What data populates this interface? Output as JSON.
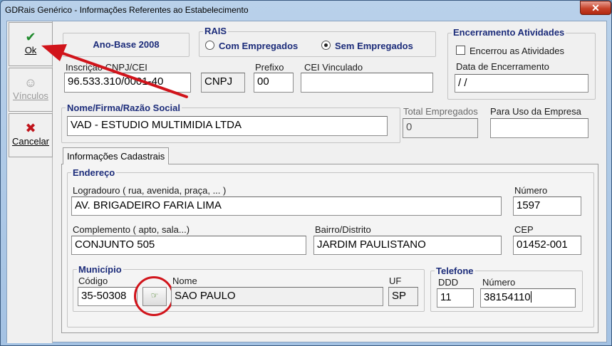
{
  "window": {
    "title": "GDRais Genérico - Informações Referentes ao Estabelecimento",
    "close_glyph": "✕"
  },
  "sidebar": {
    "ok": {
      "label": "Ok",
      "icon": "check-icon",
      "glyph": "✔"
    },
    "vinculos": {
      "label": "Vínculos",
      "icon": "person-icon",
      "glyph": "☺"
    },
    "cancelar": {
      "label": "Cancelar",
      "icon": "cross-icon",
      "glyph": "✖"
    }
  },
  "header": {
    "ano_base": "Ano-Base 2008"
  },
  "rais": {
    "title": "RAIS",
    "options": [
      "Com Empregados",
      "Sem Empregados"
    ],
    "selected": "Sem Empregados"
  },
  "identificacao": {
    "cnpj_label": "Inscrição CNPJ/CEI",
    "cnpj_value": "96.533.310/0001-40",
    "tipo": "CNPJ",
    "prefixo_label": "Prefixo",
    "prefixo_value": "00",
    "cei_label": "CEI Vinculado",
    "cei_value": ""
  },
  "encerramento": {
    "title": "Encerramento Atividades",
    "check_label": "Encerrou as Atividades",
    "data_label": "Data de Encerramento",
    "data_value": " / /"
  },
  "nome": {
    "label": "Nome/Firma/Razão Social",
    "value": "VAD - ESTUDIO MULTIMIDIA LTDA"
  },
  "total_empregados": {
    "label": "Total Empregados",
    "value": "0"
  },
  "uso_empresa": {
    "label": "Para Uso da Empresa",
    "value": ""
  },
  "tabs": [
    {
      "label": "Informações Cadastrais"
    }
  ],
  "endereco": {
    "title": "Endereço",
    "logradouro_label": "Logradouro ( rua, avenida, praça, ... )",
    "logradouro_value": "AV. BRIGADEIRO FARIA LIMA",
    "numero_label": "Número",
    "numero_value": "1597",
    "complemento_label": "Complemento ( apto, sala...)",
    "complemento_value": "CONJUNTO 505",
    "bairro_label": "Bairro/Distrito",
    "bairro_value": "JARDIM PAULISTANO",
    "cep_label": "CEP",
    "cep_value": "01452-001"
  },
  "municipio": {
    "title": "Município",
    "codigo_label": "Código",
    "codigo_value": "35-50308",
    "nome_label": "Nome",
    "nome_value": "SAO PAULO",
    "uf_label": "UF",
    "uf_value": "SP",
    "lookup_icon": "lookup-icon",
    "lookup_glyph": "☞"
  },
  "telefone": {
    "title": "Telefone",
    "ddd_label": "DDD",
    "ddd_value": "11",
    "numero_label": "Número",
    "numero_value": "38154110"
  },
  "annotation": {
    "arrow_color": "#d1141b",
    "circle_color": "#d1141b"
  }
}
